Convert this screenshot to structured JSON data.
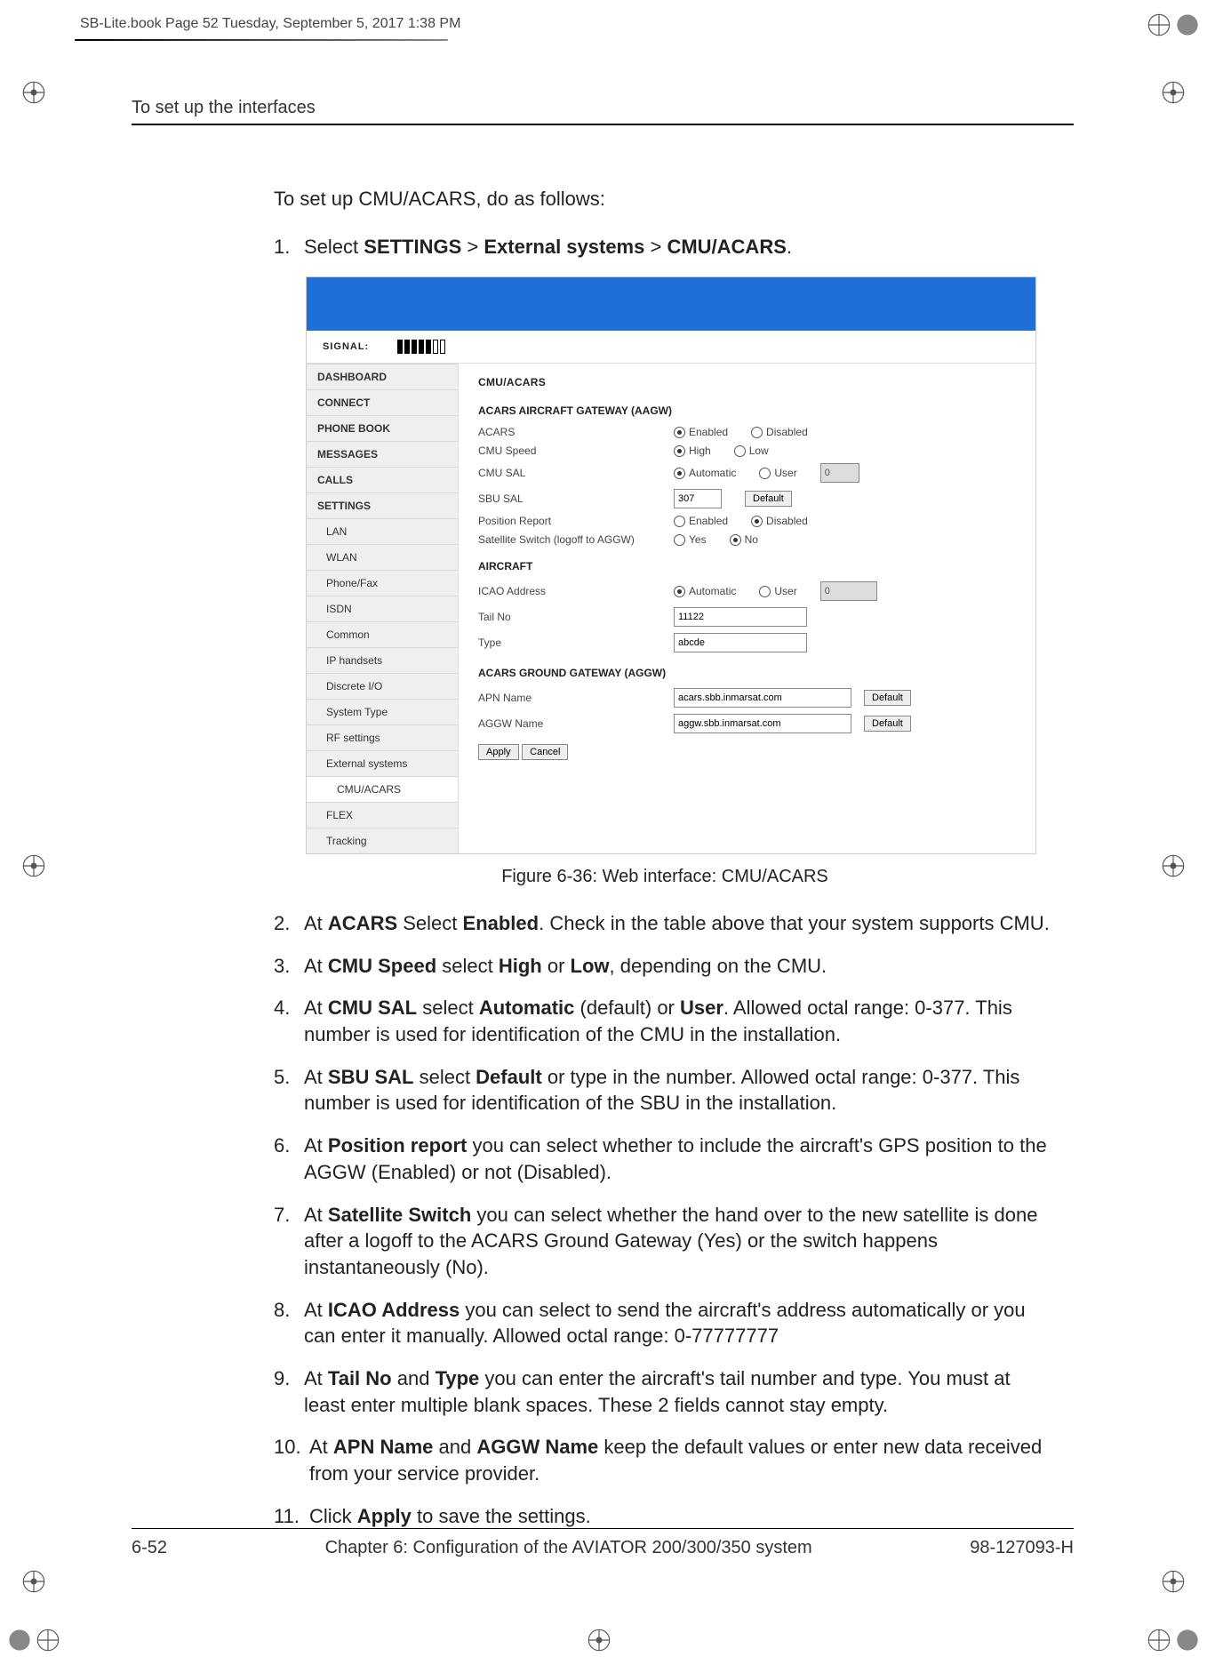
{
  "print_header": "SB-Lite.book  Page 52  Tuesday, September 5, 2017  1:38 PM",
  "running_head": "To set up the interfaces",
  "intro": "To set up CMU/ACARS, do as follows:",
  "step1_num": "1.",
  "step1_pre": "Select ",
  "step1_b1": "SETTINGS",
  "step1_sep1": " > ",
  "step1_b2": "External systems",
  "step1_sep2": " > ",
  "step1_b3": "CMU/ACARS",
  "step1_end": ".",
  "figcap": "Figure 6-36: Web interface: CMU/ACARS",
  "webui": {
    "signal_label": "SIGNAL:",
    "sidebar": [
      "DASHBOARD",
      "CONNECT",
      "PHONE BOOK",
      "MESSAGES",
      "CALLS",
      "SETTINGS",
      "LAN",
      "WLAN",
      "Phone/Fax",
      "ISDN",
      "Common",
      "IP handsets",
      "Discrete I/O",
      "System Type",
      "RF settings",
      "External systems",
      "CMU/ACARS",
      "FLEX",
      "Tracking"
    ],
    "title": "CMU/ACARS",
    "sect_aagw": "ACARS AIRCRAFT GATEWAY (AAGW)",
    "lbl_acars": "ACARS",
    "enabled": "Enabled",
    "disabled": "Disabled",
    "lbl_cmuspeed": "CMU Speed",
    "high": "High",
    "low": "Low",
    "lbl_cmusal": "CMU SAL",
    "automatic": "Automatic",
    "user": "User",
    "cmusal_user_val": "0",
    "lbl_sbusal": "SBU SAL",
    "sbusal_val": "307",
    "default_btn": "Default",
    "lbl_posrep": "Position Report",
    "lbl_satsw": "Satellite Switch (logoff to AGGW)",
    "yes": "Yes",
    "no": "No",
    "sect_aircraft": "AIRCRAFT",
    "lbl_icao": "ICAO Address",
    "icao_user_val": "0",
    "lbl_tailno": "Tail No",
    "tailno_val": "11122",
    "lbl_type": "Type",
    "type_val": "abcde",
    "sect_aggw": "ACARS GROUND GATEWAY (AGGW)",
    "lbl_apn": "APN Name",
    "apn_val": "acars.sbb.inmarsat.com",
    "lbl_aggwname": "AGGW Name",
    "aggw_val": "aggw.sbb.inmarsat.com",
    "apply": "Apply",
    "cancel": "Cancel"
  },
  "steps": {
    "s2n": "2.",
    "s2a": "At ",
    "s2b1": "ACARS",
    "s2c": " Select ",
    "s2b2": "Enabled",
    "s2d": ". Check in the table above that your system supports CMU.",
    "s3n": "3.",
    "s3a": "At ",
    "s3b1": "CMU Speed",
    "s3c": " select ",
    "s3b2": "High",
    "s3d": " or ",
    "s3b3": "Low",
    "s3e": ", depending on the CMU.",
    "s4n": "4.",
    "s4a": "At ",
    "s4b1": "CMU SAL",
    "s4c": " select ",
    "s4b2": "Automatic",
    "s4d": " (default) or ",
    "s4b3": "User",
    "s4e": ". Allowed octal range: 0-377. This number is used for identification of the CMU in the installation.",
    "s5n": "5.",
    "s5a": "At ",
    "s5b1": "SBU SAL",
    "s5c": " select ",
    "s5b2": "Default",
    "s5d": " or type in the number. Allowed octal range: 0-377. This number is used for identification of the SBU in the installation.",
    "s6n": "6.",
    "s6a": "At ",
    "s6b1": "Position report",
    "s6c": " you can select whether to include the aircraft's GPS position to the AGGW (Enabled) or not (Disabled).",
    "s7n": "7.",
    "s7a": "At ",
    "s7b1": "Satellite Switch",
    "s7c": " you can select whether the hand over to the new satellite is done after a logoff to the ACARS Ground Gateway (Yes) or the switch happens instantaneously (No).",
    "s8n": "8.",
    "s8a": "At ",
    "s8b1": "ICAO Address",
    "s8c": " you can select to send the aircraft's address automatically or you can enter it manually. Allowed octal range: 0-77777777",
    "s9n": "9.",
    "s9a": "At ",
    "s9b1": "Tail No",
    "s9c": " and ",
    "s9b2": "Type",
    "s9d": " you can enter the aircraft's tail number and type. You must at least enter multiple blank spaces. These 2 fields cannot stay empty.",
    "s10n": "10.",
    "s10a": "At ",
    "s10b1": "APN Name",
    "s10c": " and ",
    "s10b2": "AGGW Name",
    "s10d": " keep the default values or enter new data received from your service provider.",
    "s11n": "11.",
    "s11a": "Click ",
    "s11b1": "Apply",
    "s11c": " to save the settings."
  },
  "footer": {
    "page": "6-52",
    "chapter": "Chapter 6:  Configuration of the AVIATOR 200/300/350 system",
    "docnum": "98-127093-H"
  }
}
